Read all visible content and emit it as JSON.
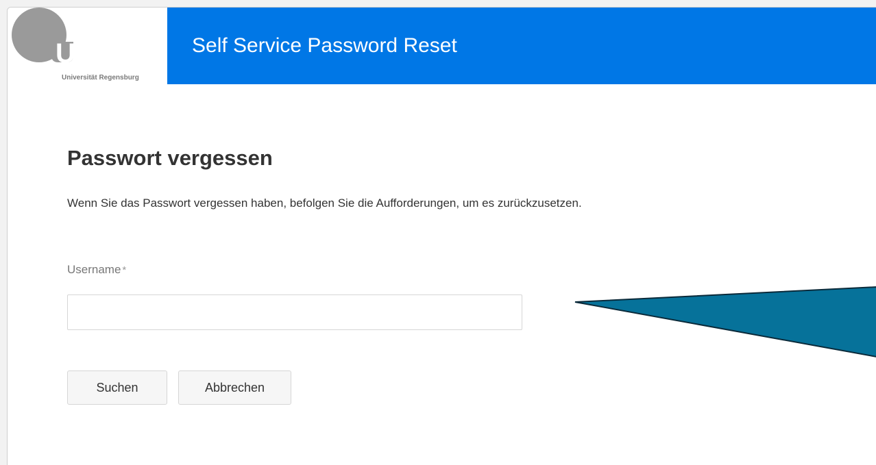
{
  "logo": {
    "mark_text": "UR",
    "caption": "Universität Regensburg"
  },
  "header": {
    "title": "Self Service Password Reset"
  },
  "main": {
    "title": "Passwort vergessen",
    "intro": "Wenn Sie das Passwort vergessen haben, befolgen Sie die Aufforderungen, um es zurückzusetzen.",
    "username_label": "Username",
    "required_marker": "*",
    "username_value": ""
  },
  "buttons": {
    "search_label": "Suchen",
    "cancel_label": "Abbrechen"
  },
  "colors": {
    "header_blue": "#0077e6",
    "callout_teal": "#06729a"
  }
}
